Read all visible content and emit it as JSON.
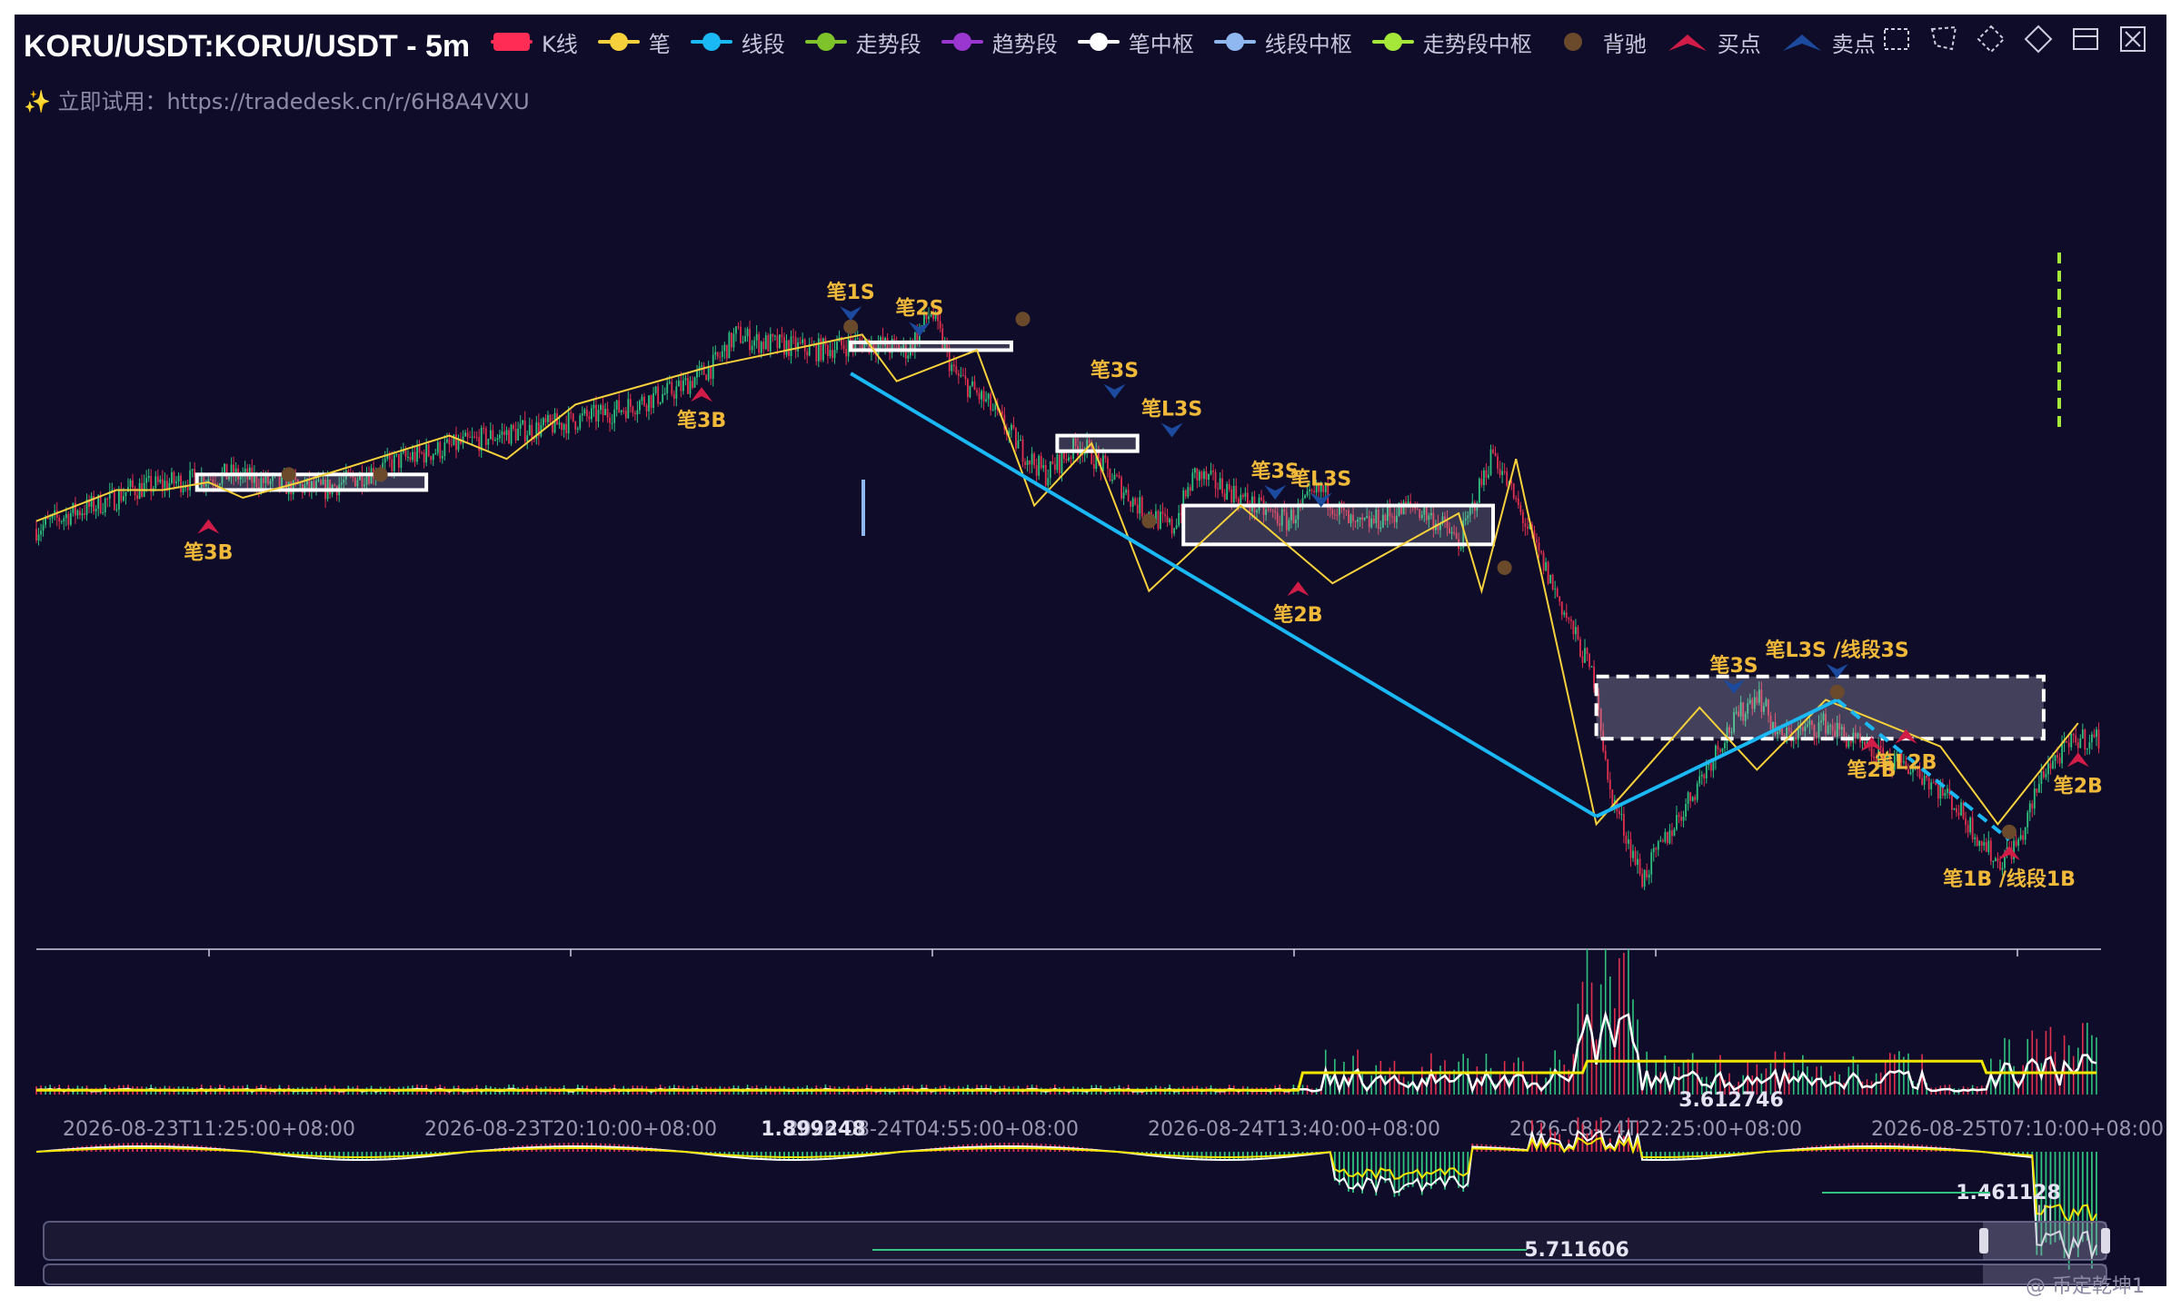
{
  "header": {
    "title": "KORU/USDT:KORU/USDT - 5m",
    "subtitle": "✨ 立即试用：https://tradedesk.cn/r/6H8A4VXU"
  },
  "legend": [
    {
      "label": "K线",
      "color": "#ff2d55",
      "shape": "rect"
    },
    {
      "label": "笔",
      "color": "#f7d13b",
      "shape": "line"
    },
    {
      "label": "线段",
      "color": "#1ab8f5",
      "shape": "line"
    },
    {
      "label": "走势段",
      "color": "#7ec32a",
      "shape": "line"
    },
    {
      "label": "趋势段",
      "color": "#9b37d1",
      "shape": "line"
    },
    {
      "label": "笔中枢",
      "color": "#ffffff",
      "shape": "line"
    },
    {
      "label": "线段中枢",
      "color": "#8fb8f0",
      "shape": "line"
    },
    {
      "label": "走势段中枢",
      "color": "#a6e83a",
      "shape": "line"
    },
    {
      "label": "背驰",
      "color": "#6b4a2c",
      "shape": "dot"
    },
    {
      "label": "买点",
      "color": "#d11c47",
      "shape": "chevron-up"
    },
    {
      "label": "卖点",
      "color": "#1c4a9e",
      "shape": "chevron-up"
    }
  ],
  "toolbox": [
    "zoom-select-icon",
    "lasso-icon",
    "zoom-reset-icon",
    "restore-icon",
    "data-view-icon",
    "save-image-icon"
  ],
  "colors": {
    "background": "#0f0c29",
    "up": "#2ec27e",
    "down": "#e0304e",
    "bi": "#f7d13b",
    "xd": "#1ab8f5",
    "zs": "#ffffff",
    "buy": "#d11c47",
    "sell": "#1c4a9e",
    "divergence": "#6b4a2c",
    "signal_label": "#f0b93a",
    "volume_line": "#ffffff",
    "volume_ma": "#f2e600",
    "macd_dif": "#ffffff",
    "macd_dea": "#f2e600"
  },
  "chart_data": [
    {
      "type": "candlestick",
      "title": "KORU/USDT:KORU/USDT - 5m",
      "x_ticks": [
        "2026-08-23T11:25:00+08:00",
        "2026-08-23T20:10:00+08:00",
        "2026-08-24T04:55:00+08:00",
        "2026-08-24T13:40:00+08:00",
        "2026-08-24T22:25:00+08:00",
        "2026-08-25T07:10:00+08:00"
      ],
      "price_path": [
        [
          0,
          2.05
        ],
        [
          3,
          2.07
        ],
        [
          7,
          2.09
        ],
        [
          8,
          2.1
        ],
        [
          12,
          2.11
        ],
        [
          17,
          2.12
        ],
        [
          20,
          2.11
        ],
        [
          25,
          2.1
        ],
        [
          32,
          2.14
        ],
        [
          40,
          2.17
        ],
        [
          44,
          2.18
        ],
        [
          50,
          2.2
        ],
        [
          56,
          2.23
        ],
        [
          59,
          2.26
        ],
        [
          61,
          2.3
        ],
        [
          63,
          2.29
        ],
        [
          68,
          2.28
        ],
        [
          72,
          2.29
        ],
        [
          76,
          2.28
        ],
        [
          78,
          2.33
        ],
        [
          80,
          2.25
        ],
        [
          83,
          2.21
        ],
        [
          86,
          2.15
        ],
        [
          88,
          2.12
        ],
        [
          91,
          2.16
        ],
        [
          93,
          2.13
        ],
        [
          96,
          2.08
        ],
        [
          99,
          2.05
        ],
        [
          101,
          2.12
        ],
        [
          104,
          2.1
        ],
        [
          106,
          2.08
        ],
        [
          109,
          2.06
        ],
        [
          112,
          2.1
        ],
        [
          115,
          2.05
        ],
        [
          120,
          2.08
        ],
        [
          123,
          2.05
        ],
        [
          124,
          2.03
        ],
        [
          127,
          2.15
        ],
        [
          130,
          2.05
        ],
        [
          133,
          1.95
        ],
        [
          136,
          1.85
        ],
        [
          137,
          1.72
        ],
        [
          140,
          1.6
        ],
        [
          144,
          1.7
        ],
        [
          147,
          1.78
        ],
        [
          150,
          1.84
        ],
        [
          152,
          1.78
        ],
        [
          156,
          1.8
        ],
        [
          160,
          1.76
        ],
        [
          164,
          1.74
        ],
        [
          167,
          1.7
        ],
        [
          171,
          1.62
        ],
        [
          173,
          1.65
        ],
        [
          175,
          1.74
        ],
        [
          178,
          1.78
        ]
      ],
      "bi": [
        [
          0,
          2.06
        ],
        [
          7,
          2.1
        ],
        [
          11,
          2.1
        ],
        [
          15,
          2.11
        ],
        [
          18,
          2.09
        ],
        [
          23,
          2.11
        ],
        [
          36,
          2.17
        ],
        [
          41,
          2.14
        ],
        [
          47,
          2.21
        ],
        [
          59,
          2.26
        ],
        [
          72,
          2.3
        ],
        [
          75,
          2.24
        ],
        [
          82,
          2.28
        ],
        [
          87,
          2.08
        ],
        [
          92,
          2.16
        ],
        [
          97,
          1.97
        ],
        [
          105,
          2.08
        ],
        [
          113,
          1.98
        ],
        [
          124,
          2.07
        ],
        [
          126,
          1.97
        ],
        [
          129,
          2.14
        ],
        [
          136,
          1.67
        ],
        [
          145,
          1.82
        ],
        [
          150,
          1.74
        ],
        [
          156,
          1.83
        ],
        [
          166,
          1.77
        ],
        [
          171,
          1.67
        ],
        [
          178,
          1.8
        ]
      ],
      "xd": [
        [
          71,
          2.25
        ],
        [
          136,
          1.68
        ],
        [
          157,
          1.83
        ],
        [
          172,
          1.65
        ]
      ],
      "zs": [
        [
          14,
          34,
          2.12,
          2.1
        ],
        [
          71,
          85,
          2.29,
          2.28
        ],
        [
          89,
          96,
          2.17,
          2.15
        ],
        [
          100,
          127,
          2.08,
          2.03
        ],
        [
          136,
          175,
          1.86,
          1.78
        ]
      ],
      "signals": [
        {
          "label": "笔3B",
          "i": 15,
          "p": 2.06,
          "kind": "buy"
        },
        {
          "label": "笔3B",
          "i": 58,
          "p": 2.23,
          "kind": "buy"
        },
        {
          "label": "笔1S",
          "i": 71,
          "p": 2.32,
          "kind": "sell"
        },
        {
          "label": "笔2S",
          "i": 77,
          "p": 2.3,
          "kind": "sell"
        },
        {
          "label": "笔3S",
          "i": 94,
          "p": 2.22,
          "kind": "sell"
        },
        {
          "label": "笔L3S",
          "i": 99,
          "p": 2.17,
          "kind": "sell"
        },
        {
          "label": "笔3S",
          "i": 108,
          "p": 2.09,
          "kind": "sell"
        },
        {
          "label": "笔L3S",
          "i": 112,
          "p": 2.08,
          "kind": "sell"
        },
        {
          "label": "笔2B",
          "i": 110,
          "p": 1.98,
          "kind": "buy"
        },
        {
          "label": "笔3S",
          "i": 148,
          "p": 1.84,
          "kind": "sell"
        },
        {
          "label": "笔L3S /线段3S",
          "i": 157,
          "p": 1.86,
          "kind": "sell"
        },
        {
          "label": "笔2B",
          "i": 160,
          "p": 1.78,
          "kind": "buy"
        },
        {
          "label": "笔L2B",
          "i": 163,
          "p": 1.79,
          "kind": "buy"
        },
        {
          "label": "笔2B",
          "i": 178,
          "p": 1.76,
          "kind": "buy"
        },
        {
          "label": "笔1B /线段1B",
          "i": 172,
          "p": 1.64,
          "kind": "buy"
        }
      ],
      "divergence_points": [
        [
          22,
          2.12
        ],
        [
          30,
          2.12
        ],
        [
          71,
          2.31
        ],
        [
          86,
          2.32
        ],
        [
          97,
          2.06
        ],
        [
          128,
          2.0
        ],
        [
          157,
          1.84
        ],
        [
          172,
          1.66
        ]
      ]
    },
    {
      "type": "bar",
      "title": "volume",
      "value_labels": [
        "3.612746"
      ]
    },
    {
      "type": "bar",
      "title": "MACD",
      "value_labels": [
        "1.899248",
        "1.461128",
        "5.711606"
      ]
    }
  ],
  "watermark": "@ 币定乾坤1"
}
